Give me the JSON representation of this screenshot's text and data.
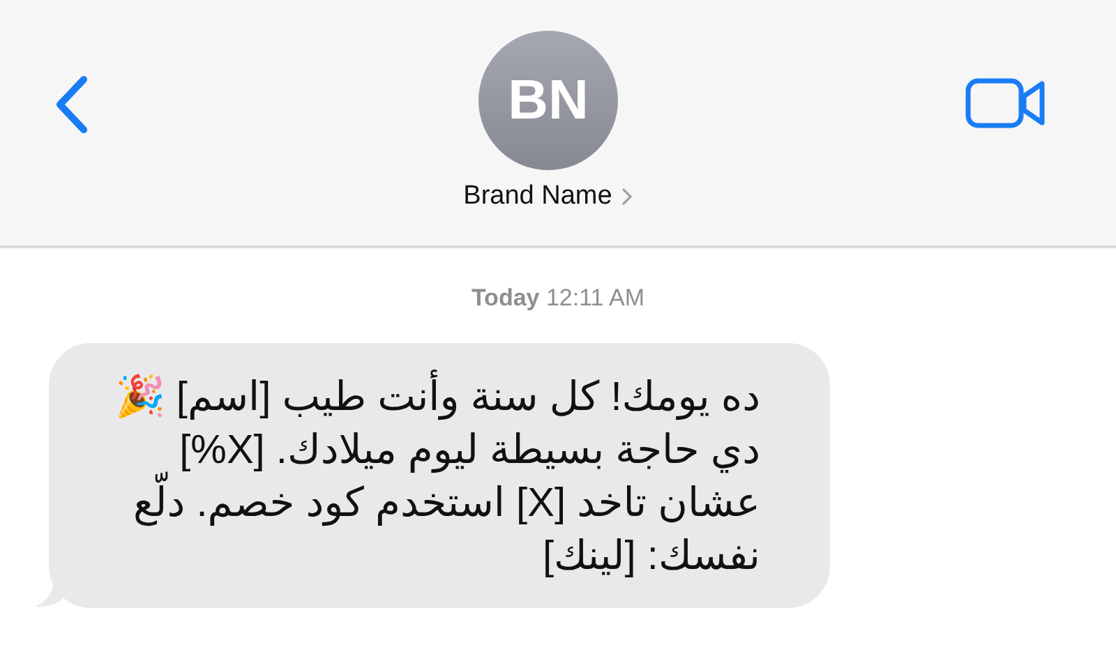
{
  "header": {
    "avatar_initials": "BN",
    "contact_name": "Brand Name"
  },
  "timestamp": {
    "day": "Today",
    "time": "12:11 AM"
  },
  "messages": [
    {
      "kind": "incoming",
      "text": "ده يومك! كل سنة وأنت طيب [اسم] 🎉 دي حاجة بسيطة ليوم ميلادك. [X%] عشان تاخد [X] استخدم كود خصم. دلّع نفسك: [لينك]"
    }
  ]
}
